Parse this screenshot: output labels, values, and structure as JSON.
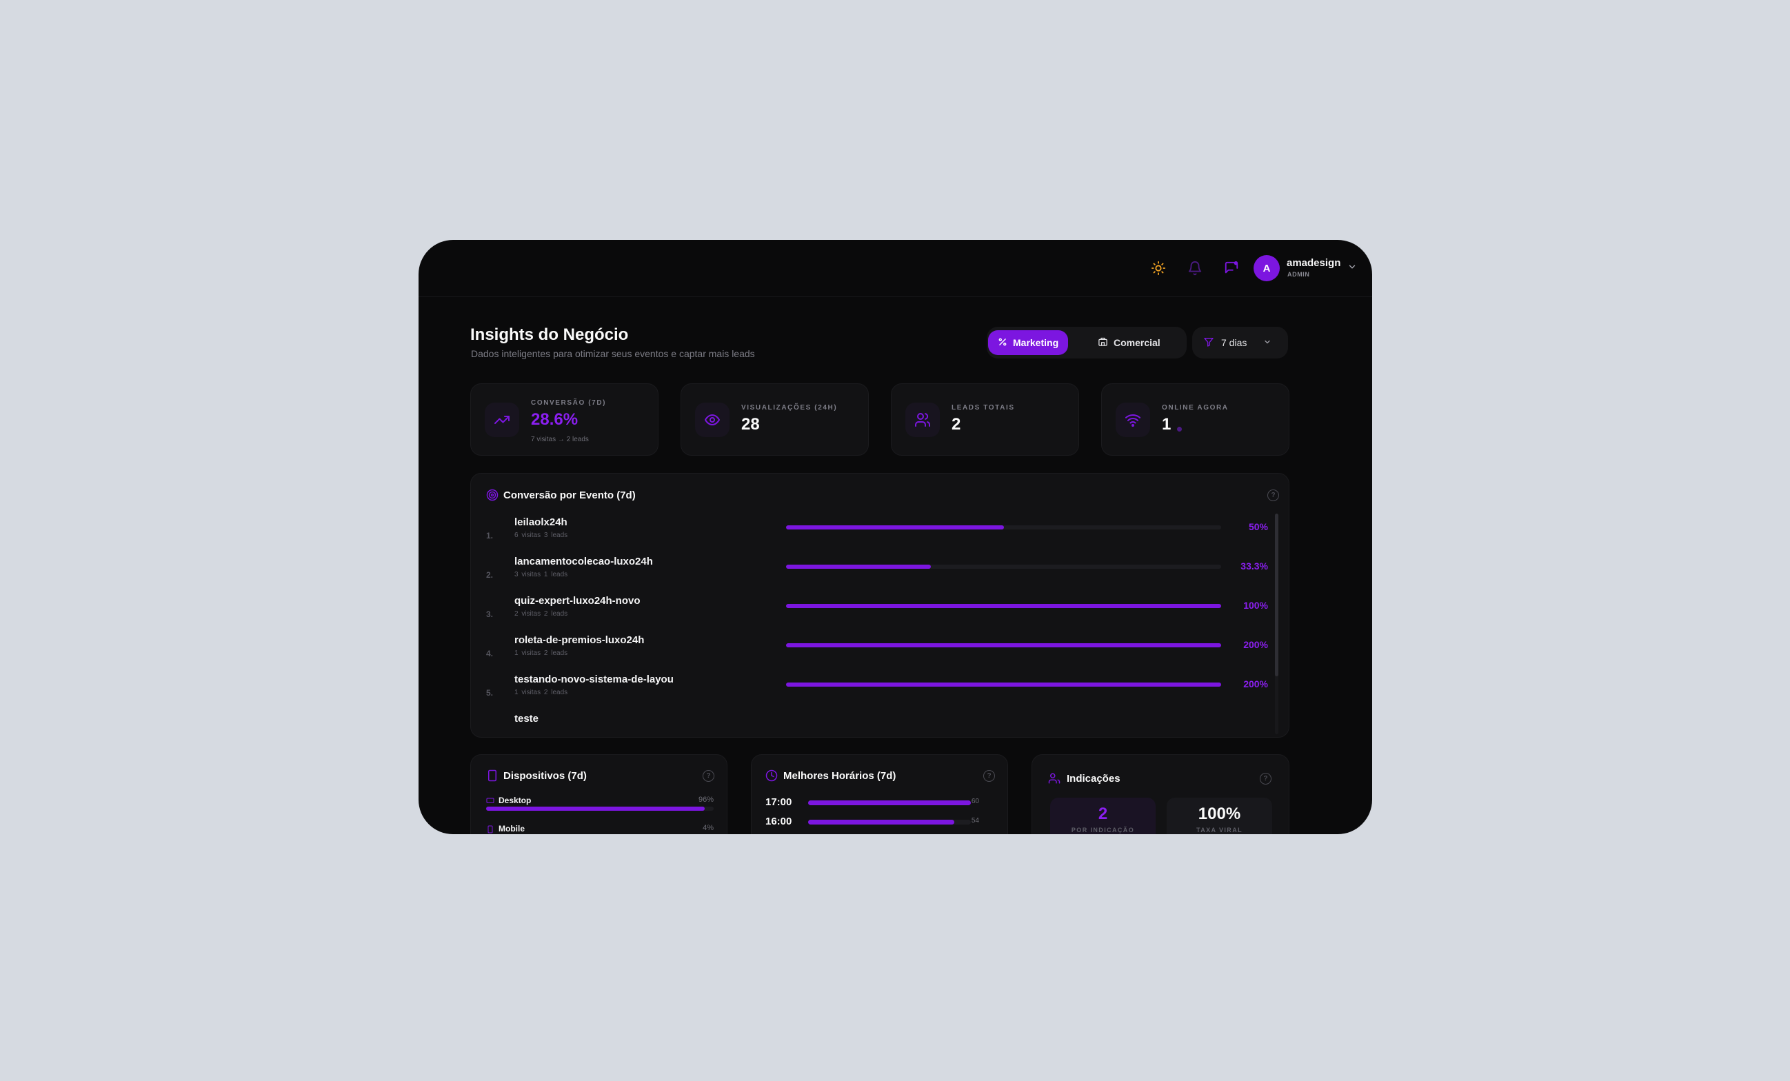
{
  "header": {
    "icons": [
      "sun-icon",
      "bell-icon",
      "message-icon"
    ],
    "avatar_initial": "A",
    "user_name": "amadesign",
    "user_role": "ADMIN"
  },
  "page": {
    "title": "Insights do Negócio",
    "subtitle": "Dados inteligentes para otimizar seus eventos e captar mais leads"
  },
  "tabs": {
    "marketing_label": "Marketing",
    "comercial_label": "Comercial",
    "active": "Marketing"
  },
  "filter": {
    "selected": "7 dias"
  },
  "kpis": {
    "conversao": {
      "label": "CONVERSÃO (7D)",
      "value": "28.6%",
      "sub": "7 visitas → 2 leads"
    },
    "visualizacoes": {
      "label": "VISUALIZAÇÕES (24H)",
      "value": "28"
    },
    "leads": {
      "label": "LEADS TOTAIS",
      "value": "2"
    },
    "online": {
      "label": "ONLINE AGORA",
      "value": "1"
    }
  },
  "conversion": {
    "title": "Conversão por Evento (7d)",
    "events": [
      {
        "index": "1.",
        "name": "leilaolx24h",
        "meta": "6 visitas 3 leads",
        "pct": "50%",
        "fill": 0.5
      },
      {
        "index": "2.",
        "name": "lancamentocolecao-luxo24h",
        "meta": "3 visitas 1 leads",
        "pct": "33.3%",
        "fill": 0.333
      },
      {
        "index": "3.",
        "name": "quiz-expert-luxo24h-novo",
        "meta": "2 visitas 2 leads",
        "pct": "100%",
        "fill": 1
      },
      {
        "index": "4.",
        "name": "roleta-de-premios-luxo24h",
        "meta": "1 visitas 2 leads",
        "pct": "200%",
        "fill": 1
      },
      {
        "index": "5.",
        "name": "testando-novo-sistema-de-layou",
        "meta": "1 visitas 2 leads",
        "pct": "200%",
        "fill": 1
      },
      {
        "index": "",
        "name": "teste",
        "meta": "",
        "pct": "",
        "fill": 0
      }
    ]
  },
  "devices": {
    "title": "Dispositivos (7d)",
    "items": [
      {
        "label": "Desktop",
        "pct": "96%",
        "fill": 0.96
      },
      {
        "label": "Mobile",
        "pct": "4%",
        "fill": 0.04
      }
    ]
  },
  "hours": {
    "title": "Melhores Horários (7d)",
    "items": [
      {
        "time": "17:00",
        "count": "60",
        "fill": 1
      },
      {
        "time": "16:00",
        "count": "54",
        "fill": 0.9
      }
    ]
  },
  "referrals": {
    "title": "Indicações",
    "per_referral": {
      "value": "2",
      "label": "POR INDICAÇÃO"
    },
    "viral_rate": {
      "value": "100%",
      "label": "TAXA VIRAL"
    }
  },
  "colors": {
    "accent": "#7c16e0",
    "accent_text": "#8b1ff0",
    "background": "#0a0a0b",
    "card": "#121214",
    "sun": "#f5a524"
  }
}
